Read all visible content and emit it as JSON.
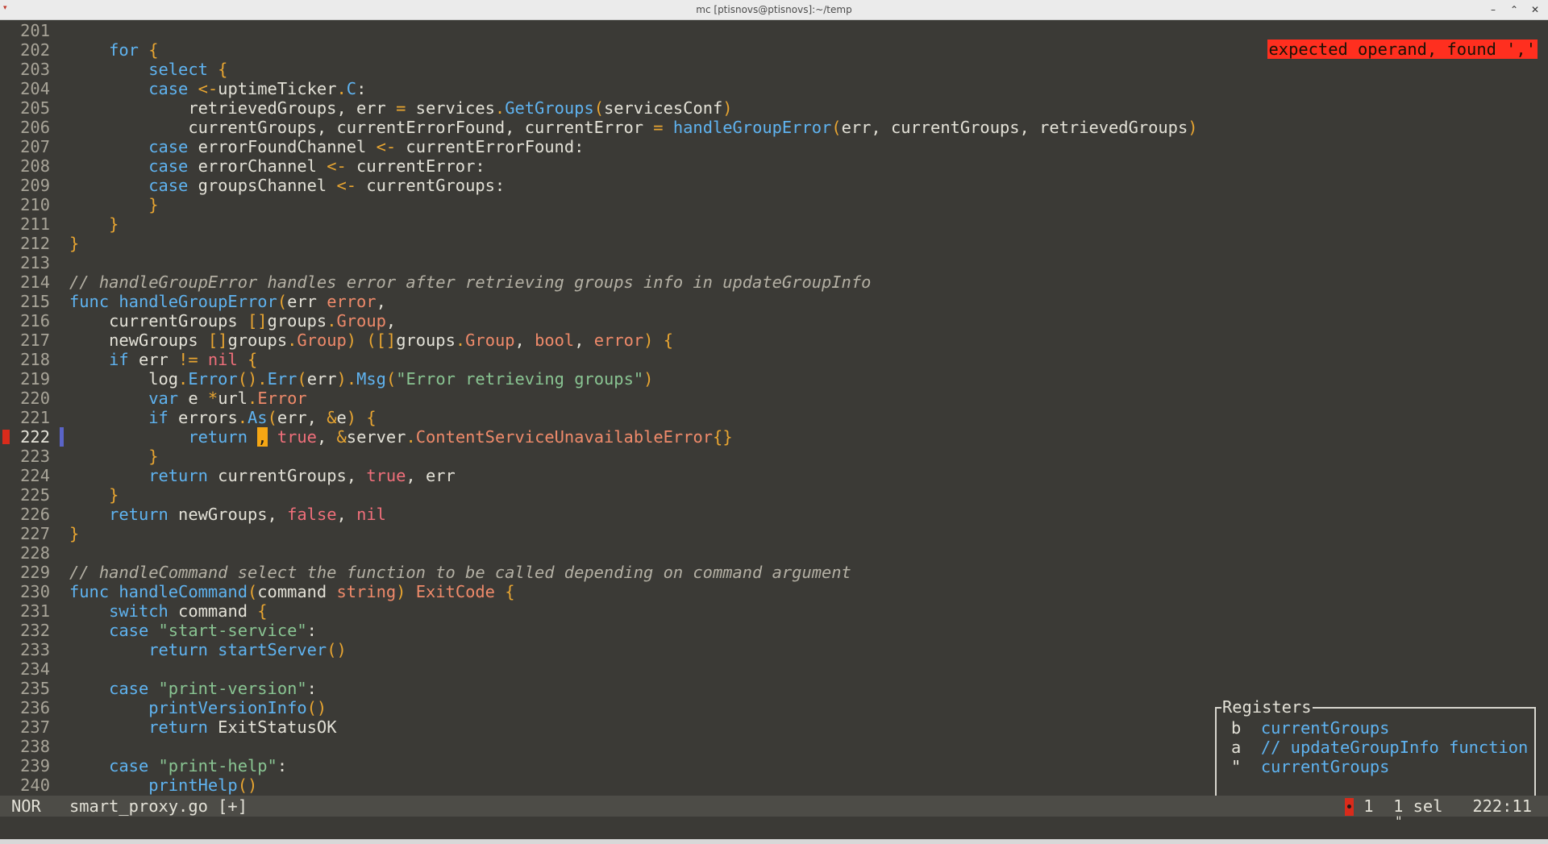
{
  "window": {
    "title": "mc [ptisnovs@ptisnovs]:~/temp",
    "minimize_glyph": "–",
    "maximize_glyph": "⌃",
    "close_glyph": "✕",
    "menu_glyph": "▾"
  },
  "editor": {
    "current_line": 222,
    "diagnostic_message": "expected operand, found ','",
    "lines": [
      {
        "n": "201",
        "tokens": []
      },
      {
        "n": "202",
        "tokens": [
          [
            "",
            "    "
          ],
          [
            "kw",
            "for"
          ],
          [
            "",
            " "
          ],
          [
            "br",
            "{"
          ]
        ]
      },
      {
        "n": "203",
        "tokens": [
          [
            "",
            "        "
          ],
          [
            "kw",
            "select"
          ],
          [
            "",
            " "
          ],
          [
            "br",
            "{"
          ]
        ]
      },
      {
        "n": "204",
        "tokens": [
          [
            "",
            "        "
          ],
          [
            "kw",
            "case"
          ],
          [
            "",
            " "
          ],
          [
            "op",
            "<-"
          ],
          [
            "",
            "uptimeTicker"
          ],
          [
            "dot",
            "."
          ],
          [
            "fn",
            "C"
          ],
          [
            "",
            ":"
          ]
        ]
      },
      {
        "n": "205",
        "tokens": [
          [
            "",
            "            retrievedGroups, err "
          ],
          [
            "op",
            "="
          ],
          [
            "",
            " services"
          ],
          [
            "dot",
            "."
          ],
          [
            "fn",
            "GetGroups"
          ],
          [
            "br",
            "("
          ],
          [
            "",
            "servicesConf"
          ],
          [
            "br",
            ")"
          ]
        ]
      },
      {
        "n": "206",
        "tokens": [
          [
            "",
            "            currentGroups, currentErrorFound, currentError "
          ],
          [
            "op",
            "="
          ],
          [
            "",
            " "
          ],
          [
            "fn",
            "handleGroupError"
          ],
          [
            "br",
            "("
          ],
          [
            "",
            "err, currentGroups, retrievedGroups"
          ],
          [
            "br",
            ")"
          ]
        ]
      },
      {
        "n": "207",
        "tokens": [
          [
            "",
            "        "
          ],
          [
            "kw",
            "case"
          ],
          [
            "",
            " errorFoundChannel "
          ],
          [
            "op",
            "<-"
          ],
          [
            "",
            " currentErrorFound:"
          ]
        ]
      },
      {
        "n": "208",
        "tokens": [
          [
            "",
            "        "
          ],
          [
            "kw",
            "case"
          ],
          [
            "",
            " errorChannel "
          ],
          [
            "op",
            "<-"
          ],
          [
            "",
            " currentError:"
          ]
        ]
      },
      {
        "n": "209",
        "tokens": [
          [
            "",
            "        "
          ],
          [
            "kw",
            "case"
          ],
          [
            "",
            " groupsChannel "
          ],
          [
            "op",
            "<-"
          ],
          [
            "",
            " currentGroups:"
          ]
        ]
      },
      {
        "n": "210",
        "tokens": [
          [
            "",
            "        "
          ],
          [
            "br",
            "}"
          ]
        ]
      },
      {
        "n": "211",
        "tokens": [
          [
            "",
            "    "
          ],
          [
            "br",
            "}"
          ]
        ]
      },
      {
        "n": "212",
        "tokens": [
          [
            "br",
            "}"
          ]
        ]
      },
      {
        "n": "213",
        "tokens": []
      },
      {
        "n": "214",
        "tokens": [
          [
            "cm",
            "// handleGroupError handles error after retrieving groups info in updateGroupInfo"
          ]
        ]
      },
      {
        "n": "215",
        "tokens": [
          [
            "kw",
            "func"
          ],
          [
            "",
            " "
          ],
          [
            "fn",
            "handleGroupError"
          ],
          [
            "br",
            "("
          ],
          [
            "",
            "err "
          ],
          [
            "ty",
            "error"
          ],
          [
            "",
            ","
          ]
        ]
      },
      {
        "n": "216",
        "tokens": [
          [
            "",
            "    currentGroups "
          ],
          [
            "br",
            "[]"
          ],
          [
            "",
            "groups"
          ],
          [
            "dot",
            "."
          ],
          [
            "ty",
            "Group"
          ],
          [
            "",
            ","
          ]
        ]
      },
      {
        "n": "217",
        "tokens": [
          [
            "",
            "    newGroups "
          ],
          [
            "br",
            "[]"
          ],
          [
            "",
            "groups"
          ],
          [
            "dot",
            "."
          ],
          [
            "ty",
            "Group"
          ],
          [
            "br",
            ")"
          ],
          [
            "",
            " "
          ],
          [
            "br",
            "([]"
          ],
          [
            "",
            "groups"
          ],
          [
            "dot",
            "."
          ],
          [
            "ty",
            "Group"
          ],
          [
            "",
            ", "
          ],
          [
            "ty",
            "bool"
          ],
          [
            "",
            ", "
          ],
          [
            "ty",
            "error"
          ],
          [
            "br",
            ")"
          ],
          [
            "",
            " "
          ],
          [
            "br",
            "{"
          ]
        ]
      },
      {
        "n": "218",
        "tokens": [
          [
            "",
            "    "
          ],
          [
            "kw",
            "if"
          ],
          [
            "",
            " err "
          ],
          [
            "op",
            "!="
          ],
          [
            "",
            " "
          ],
          [
            "bool",
            "nil"
          ],
          [
            "",
            " "
          ],
          [
            "br",
            "{"
          ]
        ]
      },
      {
        "n": "219",
        "tokens": [
          [
            "",
            "        log"
          ],
          [
            "dot",
            "."
          ],
          [
            "fn",
            "Error"
          ],
          [
            "br",
            "()"
          ],
          [
            "dot",
            "."
          ],
          [
            "fn",
            "Err"
          ],
          [
            "br",
            "("
          ],
          [
            "",
            "err"
          ],
          [
            "br",
            ")"
          ],
          [
            "dot",
            "."
          ],
          [
            "fn",
            "Msg"
          ],
          [
            "br",
            "("
          ],
          [
            "str",
            "\"Error retrieving groups\""
          ],
          [
            "br",
            ")"
          ]
        ]
      },
      {
        "n": "220",
        "tokens": [
          [
            "",
            "        "
          ],
          [
            "kw",
            "var"
          ],
          [
            "",
            " e "
          ],
          [
            "op",
            "*"
          ],
          [
            "",
            "url"
          ],
          [
            "dot",
            "."
          ],
          [
            "ty",
            "Error"
          ]
        ]
      },
      {
        "n": "221",
        "tokens": [
          [
            "",
            "        "
          ],
          [
            "kw",
            "if"
          ],
          [
            "",
            " errors"
          ],
          [
            "dot",
            "."
          ],
          [
            "fn",
            "As"
          ],
          [
            "br",
            "("
          ],
          [
            "",
            "err, "
          ],
          [
            "op",
            "&"
          ],
          [
            "",
            "e"
          ],
          [
            "br",
            ")"
          ],
          [
            "",
            " "
          ],
          [
            "br",
            "{"
          ]
        ]
      },
      {
        "n": "222",
        "tokens": [
          [
            "",
            "            "
          ],
          [
            "kw",
            "return"
          ],
          [
            "",
            " "
          ],
          [
            "cursor",
            ","
          ],
          [
            "",
            " "
          ],
          [
            "bool",
            "true"
          ],
          [
            "",
            ", "
          ],
          [
            "op",
            "&"
          ],
          [
            "",
            "server"
          ],
          [
            "dot",
            "."
          ],
          [
            "ty",
            "ContentServiceUnavailableError"
          ],
          [
            "br",
            "{}"
          ]
        ]
      },
      {
        "n": "223",
        "tokens": [
          [
            "",
            "        "
          ],
          [
            "br",
            "}"
          ]
        ]
      },
      {
        "n": "224",
        "tokens": [
          [
            "",
            "        "
          ],
          [
            "kw",
            "return"
          ],
          [
            "",
            " currentGroups, "
          ],
          [
            "bool",
            "true"
          ],
          [
            "",
            ", err"
          ]
        ]
      },
      {
        "n": "225",
        "tokens": [
          [
            "",
            "    "
          ],
          [
            "br",
            "}"
          ]
        ]
      },
      {
        "n": "226",
        "tokens": [
          [
            "",
            "    "
          ],
          [
            "kw",
            "return"
          ],
          [
            "",
            " newGroups, "
          ],
          [
            "bool",
            "false"
          ],
          [
            "",
            ", "
          ],
          [
            "bool",
            "nil"
          ]
        ]
      },
      {
        "n": "227",
        "tokens": [
          [
            "br",
            "}"
          ]
        ]
      },
      {
        "n": "228",
        "tokens": []
      },
      {
        "n": "229",
        "tokens": [
          [
            "cm",
            "// handleCommand select the function to be called depending on command argument"
          ]
        ]
      },
      {
        "n": "230",
        "tokens": [
          [
            "kw",
            "func"
          ],
          [
            "",
            " "
          ],
          [
            "fn",
            "handleCommand"
          ],
          [
            "br",
            "("
          ],
          [
            "",
            "command "
          ],
          [
            "ty",
            "string"
          ],
          [
            "br",
            ")"
          ],
          [
            "",
            " "
          ],
          [
            "ty",
            "ExitCode"
          ],
          [
            "",
            " "
          ],
          [
            "br",
            "{"
          ]
        ]
      },
      {
        "n": "231",
        "tokens": [
          [
            "",
            "    "
          ],
          [
            "kw",
            "switch"
          ],
          [
            "",
            " command "
          ],
          [
            "br",
            "{"
          ]
        ]
      },
      {
        "n": "232",
        "tokens": [
          [
            "",
            "    "
          ],
          [
            "kw",
            "case"
          ],
          [
            "",
            " "
          ],
          [
            "str",
            "\"start-service\""
          ],
          [
            "",
            ":"
          ]
        ]
      },
      {
        "n": "233",
        "tokens": [
          [
            "",
            "        "
          ],
          [
            "kw",
            "return"
          ],
          [
            "",
            " "
          ],
          [
            "fn",
            "startServer"
          ],
          [
            "br",
            "()"
          ]
        ]
      },
      {
        "n": "234",
        "tokens": []
      },
      {
        "n": "235",
        "tokens": [
          [
            "",
            "    "
          ],
          [
            "kw",
            "case"
          ],
          [
            "",
            " "
          ],
          [
            "str",
            "\"print-version\""
          ],
          [
            "",
            ":"
          ]
        ]
      },
      {
        "n": "236",
        "tokens": [
          [
            "",
            "        "
          ],
          [
            "fn",
            "printVersionInfo"
          ],
          [
            "br",
            "()"
          ]
        ]
      },
      {
        "n": "237",
        "tokens": [
          [
            "",
            "        "
          ],
          [
            "kw",
            "return"
          ],
          [
            "",
            " ExitStatusOK"
          ]
        ]
      },
      {
        "n": "238",
        "tokens": []
      },
      {
        "n": "239",
        "tokens": [
          [
            "",
            "    "
          ],
          [
            "kw",
            "case"
          ],
          [
            "",
            " "
          ],
          [
            "str",
            "\"print-help\""
          ],
          [
            "",
            ":"
          ]
        ]
      },
      {
        "n": "240",
        "tokens": [
          [
            "",
            "        "
          ],
          [
            "fn",
            "printHelp"
          ],
          [
            "br",
            "()"
          ]
        ]
      }
    ]
  },
  "registers": {
    "title": "Registers",
    "items": [
      {
        "key": "b",
        "value": "currentGroups"
      },
      {
        "key": "a",
        "value": "// updateGroupInfo function"
      },
      {
        "key": "\"",
        "value": "currentGroups"
      }
    ]
  },
  "statusbar": {
    "mode": "NOR",
    "file": "smart_proxy.go [+]",
    "diagnostics_count": "1",
    "selections": "1 sel",
    "position": "222:11"
  },
  "cmdline": {
    "pending_register": "\""
  },
  "colors": {
    "background": "#3b3a36",
    "keyword": "#5fb3f0",
    "type": "#ef8a6a",
    "string": "#89c492",
    "bracket": "#e8a531",
    "literal": "#ef6f7a",
    "error": "#ff2f1f",
    "cursor": "#f5a614"
  }
}
